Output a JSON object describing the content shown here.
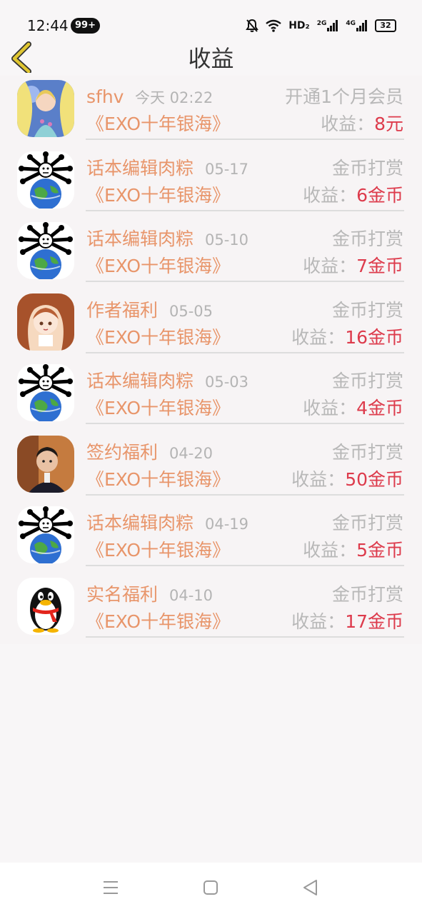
{
  "status_bar": {
    "time": "12:44",
    "notification_badge": "99+",
    "network_hd": "HD₂",
    "net_2g": "2G",
    "net_4g": "4G",
    "battery": "32"
  },
  "header": {
    "title": "收益",
    "back_icon": "chevron-left-icon",
    "accent_color": "#e0c631"
  },
  "earnings": [
    {
      "name": "sfhv",
      "date": "今天 02:22",
      "type": "开通1个月会员",
      "book": "《EXO十年银海》",
      "earn_label": "收益：",
      "earn_value": "8元",
      "avatar": "mermaid-avatar"
    },
    {
      "name": "话本编辑肉粽",
      "date": "05-17",
      "type": "金币打赏",
      "book": "《EXO十年银海》",
      "earn_label": "收益：",
      "earn_value": "6金币",
      "avatar": "globe-meme-avatar"
    },
    {
      "name": "话本编辑肉粽",
      "date": "05-10",
      "type": "金币打赏",
      "book": "《EXO十年银海》",
      "earn_label": "收益：",
      "earn_value": "7金币",
      "avatar": "globe-meme-avatar"
    },
    {
      "name": "作者福利",
      "date": "05-05",
      "type": "金币打赏",
      "book": "《EXO十年银海》",
      "earn_label": "收益：",
      "earn_value": "16金币",
      "avatar": "anime-girl-avatar"
    },
    {
      "name": "话本编辑肉粽",
      "date": "05-03",
      "type": "金币打赏",
      "book": "《EXO十年银海》",
      "earn_label": "收益：",
      "earn_value": "4金币",
      "avatar": "globe-meme-avatar"
    },
    {
      "name": "签约福利",
      "date": "04-20",
      "type": "金币打赏",
      "book": "《EXO十年银海》",
      "earn_label": "收益：",
      "earn_value": "50金币",
      "avatar": "man-photo-avatar"
    },
    {
      "name": "话本编辑肉粽",
      "date": "04-19",
      "type": "金币打赏",
      "book": "《EXO十年银海》",
      "earn_label": "收益：",
      "earn_value": "5金币",
      "avatar": "globe-meme-avatar"
    },
    {
      "name": "实名福利",
      "date": "04-10",
      "type": "金币打赏",
      "book": "《EXO十年银海》",
      "earn_label": "收益：",
      "earn_value": "17金币",
      "avatar": "qq-penguin-avatar"
    }
  ],
  "colors": {
    "name": "#e8956a",
    "muted": "#b8b8b8",
    "amount": "#dd3b4c",
    "background": "#f8f6f7"
  },
  "nav_bar": {
    "menu_icon": "menu-icon",
    "home_icon": "square-home-icon",
    "back_icon": "triangle-back-icon"
  }
}
